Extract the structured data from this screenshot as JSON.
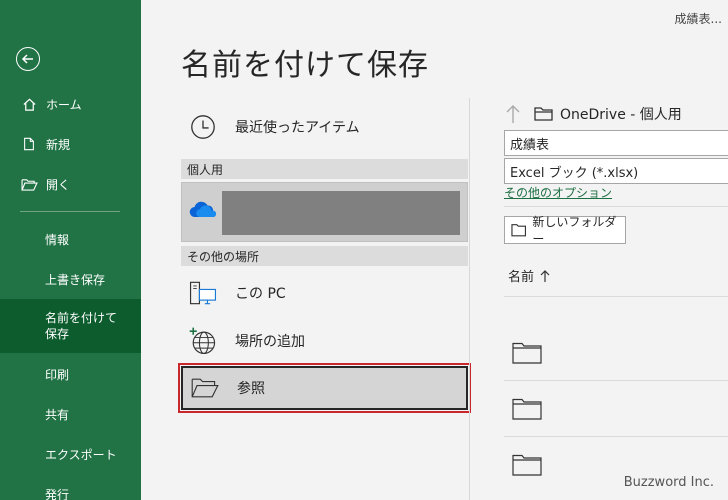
{
  "doc_name": "成績表...",
  "sidebar": {
    "items": [
      {
        "label": "ホーム"
      },
      {
        "label": "新規"
      },
      {
        "label": "開く"
      },
      {
        "label": "情報"
      },
      {
        "label": "上書き保存"
      },
      {
        "label": "名前を付けて保存"
      },
      {
        "label": "印刷"
      },
      {
        "label": "共有"
      },
      {
        "label": "エクスポート"
      },
      {
        "label": "発行"
      }
    ],
    "active_index": 5
  },
  "main": {
    "title": "名前を付けて保存",
    "recent_label": "最近使ったアイテム",
    "personal_header": "個人用",
    "other_header": "その他の場所",
    "this_pc_label": "この PC",
    "add_place_label": "場所の追加",
    "browse_label": "参照"
  },
  "right": {
    "path": "OneDrive - 個人用",
    "file_name": "成績表",
    "file_type": "Excel ブック (*.xlsx)",
    "options_link": "その他のオプション",
    "new_folder_label": "新しいフォルダー",
    "name_column": "名前"
  },
  "watermark": "Buzzword Inc.",
  "colors": {
    "sidebar": "#217346",
    "sidebar_active": "#0d5c2e",
    "highlight": "#c8272c",
    "link": "#1d6f42"
  }
}
